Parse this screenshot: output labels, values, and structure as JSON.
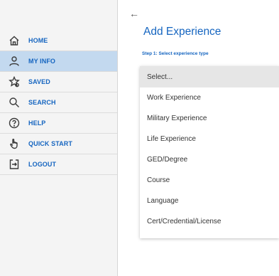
{
  "nav": {
    "items": [
      {
        "label": "HOME",
        "icon": "home-icon"
      },
      {
        "label": "MY INFO",
        "icon": "user-icon",
        "active": true
      },
      {
        "label": "SAVED",
        "icon": "star-icon"
      },
      {
        "label": "SEARCH",
        "icon": "search-icon"
      },
      {
        "label": "HELP",
        "icon": "help-icon"
      },
      {
        "label": "QUICK START",
        "icon": "pointer-icon"
      },
      {
        "label": "LOGOUT",
        "icon": "logout-icon"
      }
    ]
  },
  "main": {
    "back": "←",
    "title": "Add Experience",
    "step_label": "Step 1: Select experience type"
  },
  "dropdown": {
    "options": [
      "Select...",
      "Work Experience",
      "Military Experience",
      "Life Experience",
      "GED/Degree",
      "Course",
      "Language",
      "Cert/Credential/License"
    ]
  },
  "colors": {
    "accent": "#1565c0",
    "active_bg": "#c3d9ef",
    "sidebar_bg": "#f4f4f4"
  }
}
